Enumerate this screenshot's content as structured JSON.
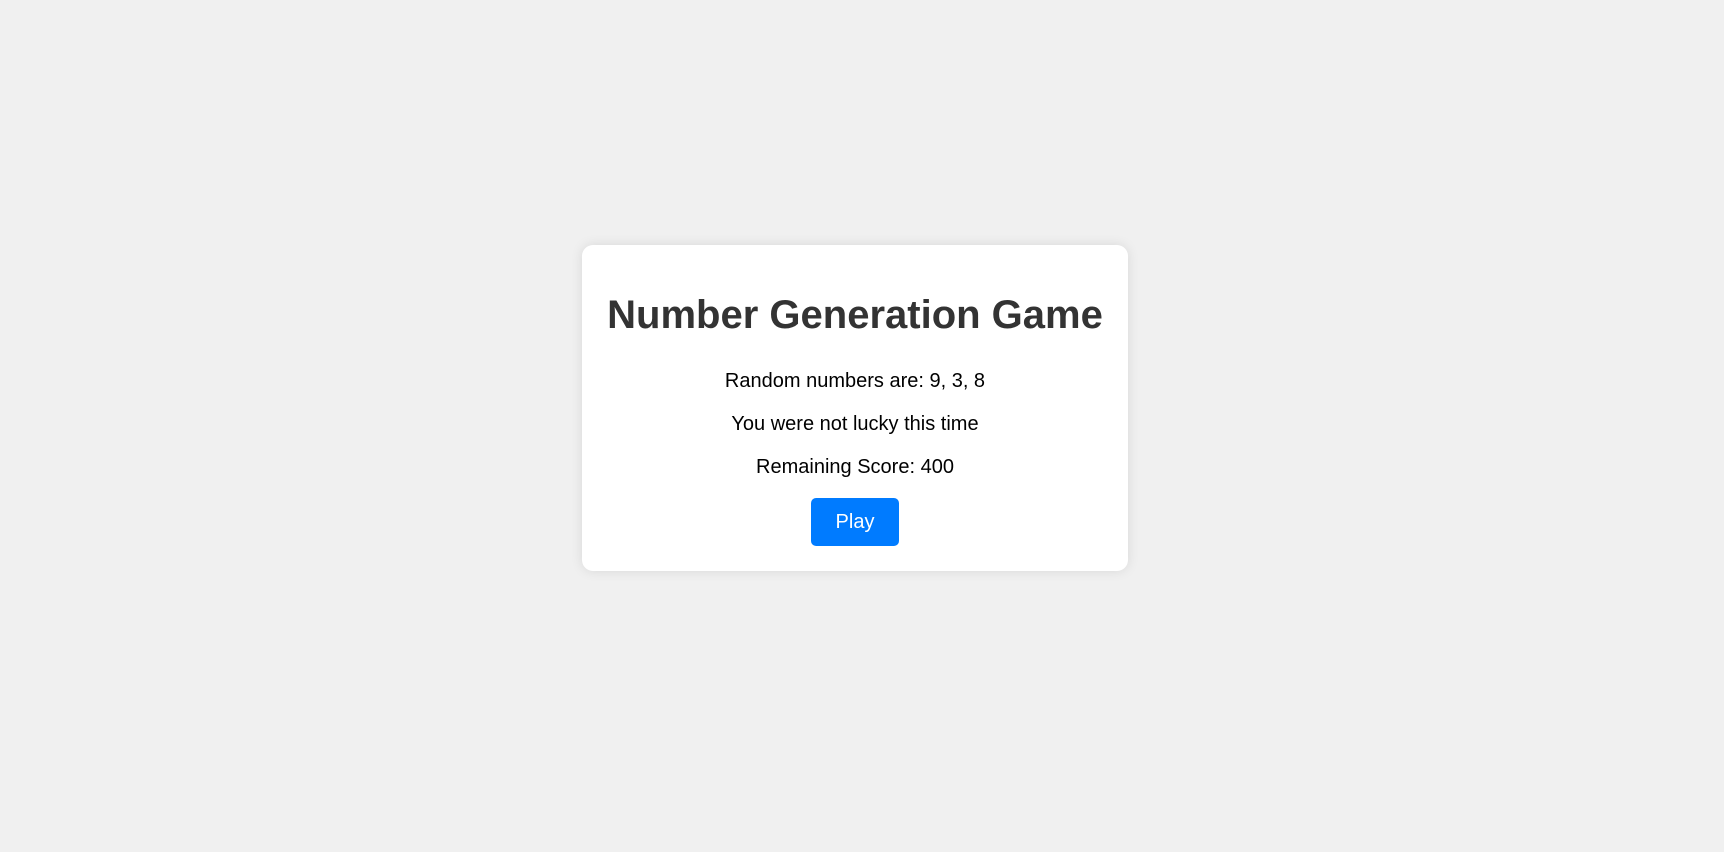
{
  "game": {
    "title": "Number Generation Game",
    "random_numbers_text": "Random numbers are: 9, 3, 8",
    "result_text": "You were not lucky this time",
    "score_text": "Remaining Score: 400",
    "play_label": "Play"
  },
  "colors": {
    "background": "#f0f0f0",
    "card": "#ffffff",
    "title": "#333333",
    "button": "#007bff",
    "button_text": "#ffffff"
  }
}
